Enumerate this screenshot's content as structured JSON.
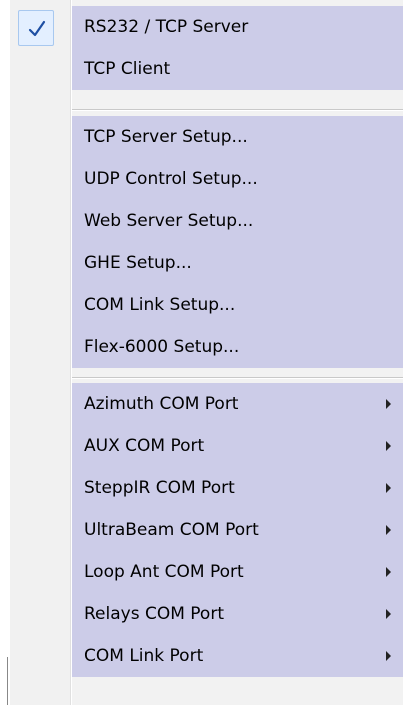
{
  "menu": {
    "checked_mark": "✓",
    "groups": [
      {
        "items": [
          {
            "label": "RS232 / TCP Server",
            "checked": true,
            "submenu": false
          },
          {
            "label": "TCP Client",
            "checked": false,
            "submenu": false
          }
        ]
      },
      {
        "items": [
          {
            "label": "TCP Server Setup...",
            "checked": false,
            "submenu": false
          },
          {
            "label": "UDP Control Setup...",
            "checked": false,
            "submenu": false
          },
          {
            "label": "Web Server Setup...",
            "checked": false,
            "submenu": false
          },
          {
            "label": "GHE Setup...",
            "checked": false,
            "submenu": false
          },
          {
            "label": "COM Link Setup...",
            "checked": false,
            "submenu": false
          },
          {
            "label": "Flex-6000 Setup...",
            "checked": false,
            "submenu": false
          }
        ]
      },
      {
        "items": [
          {
            "label": "Azimuth COM Port",
            "checked": false,
            "submenu": true
          },
          {
            "label": "AUX COM Port",
            "checked": false,
            "submenu": true
          },
          {
            "label": "SteppIR COM Port",
            "checked": false,
            "submenu": true
          },
          {
            "label": "UltraBeam COM Port",
            "checked": false,
            "submenu": true
          },
          {
            "label": "Loop Ant COM Port",
            "checked": false,
            "submenu": true
          },
          {
            "label": "Relays COM Port",
            "checked": false,
            "submenu": true
          },
          {
            "label": "COM Link Port",
            "checked": false,
            "submenu": true
          }
        ]
      }
    ],
    "colors": {
      "item_highlight": "#cccce8",
      "gutter": "#f1f1f1",
      "check_bg": "#e3efff",
      "check_mark": "#1e4fa3"
    }
  }
}
